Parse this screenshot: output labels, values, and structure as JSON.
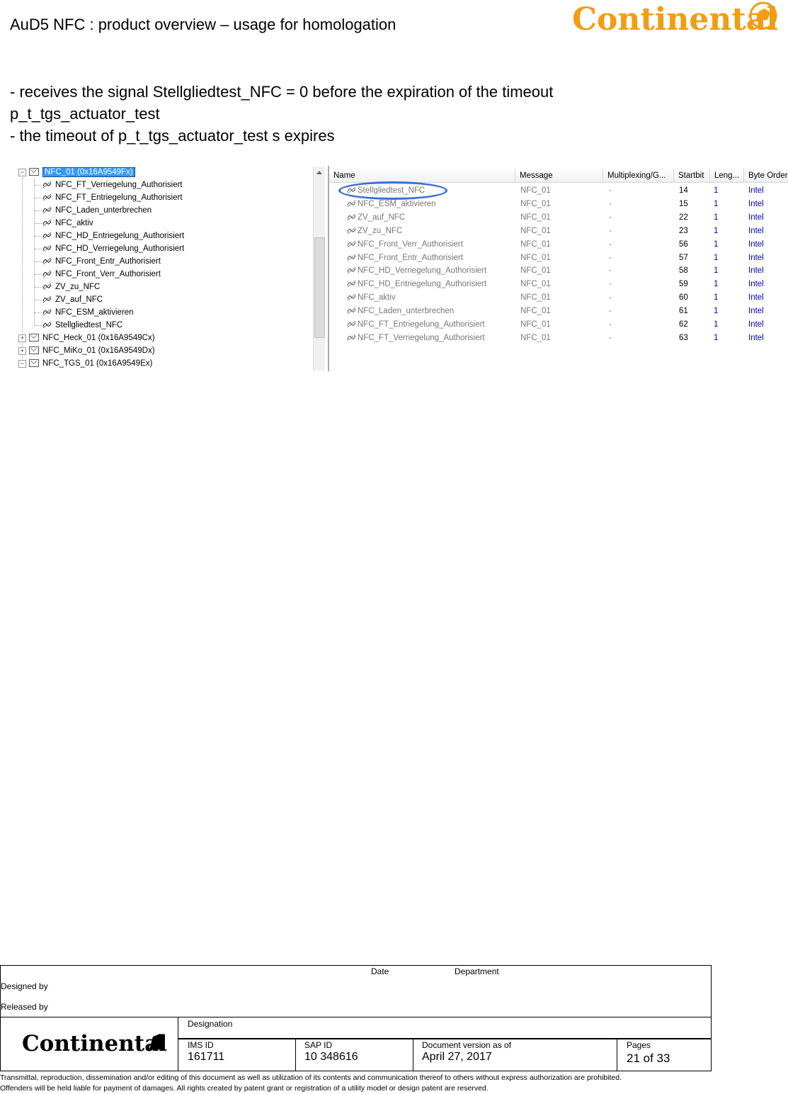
{
  "header": {
    "title": "AuD5 NFC : product overview – usage for homologation",
    "logo_text": "Continental"
  },
  "body": {
    "lines": [
      "- receives the signal Stellgliedtest_NFC = 0 before the expiration of the timeout",
      "p_t_tgs_actuator_test",
      "- the timeout of p_t_tgs_actuator_test s expires"
    ]
  },
  "tree": {
    "root": "NFC_01 (0x16A9549Fx)",
    "children": [
      "NFC_FT_Verriegelung_Authorisiert",
      "NFC_FT_Entriegelung_Authorisiert",
      "NFC_Laden_unterbrechen",
      "NFC_aktiv",
      "NFC_HD_Entriegelung_Authorisiert",
      "NFC_HD_Verriegelung_Authorisiert",
      "NFC_Front_Entr_Authorisiert",
      "NFC_Front_Verr_Authorisiert",
      "ZV_zu_NFC",
      "ZV_auf_NFC",
      "NFC_ESM_aktivieren",
      "Stellgliedtest_NFC"
    ],
    "siblings": [
      "NFC_Heck_01 (0x16A9549Cx)",
      "NFC_MiKo_01 (0x16A9549Dx)",
      "NFC_TGS_01 (0x16A9549Ex)"
    ]
  },
  "grid": {
    "columns": [
      "Name",
      "Message",
      "Multiplexing/G...",
      "Startbit",
      "Leng...",
      "Byte Order"
    ],
    "rows": [
      {
        "name": "Stellgliedtest_NFC",
        "message": "NFC_01",
        "mux": "-",
        "startbit": "14",
        "length": "1",
        "order": "Intel"
      },
      {
        "name": "NFC_ESM_aktivieren",
        "message": "NFC_01",
        "mux": "-",
        "startbit": "15",
        "length": "1",
        "order": "Intel"
      },
      {
        "name": "ZV_auf_NFC",
        "message": "NFC_01",
        "mux": "-",
        "startbit": "22",
        "length": "1",
        "order": "Intel"
      },
      {
        "name": "ZV_zu_NFC",
        "message": "NFC_01",
        "mux": "-",
        "startbit": "23",
        "length": "1",
        "order": "Intel"
      },
      {
        "name": "NFC_Front_Verr_Authorisiert",
        "message": "NFC_01",
        "mux": "-",
        "startbit": "56",
        "length": "1",
        "order": "Intel"
      },
      {
        "name": "NFC_Front_Entr_Authorisiert",
        "message": "NFC_01",
        "mux": "-",
        "startbit": "57",
        "length": "1",
        "order": "Intel"
      },
      {
        "name": "NFC_HD_Verriegelung_Authorisiert",
        "message": "NFC_01",
        "mux": "-",
        "startbit": "58",
        "length": "1",
        "order": "Intel"
      },
      {
        "name": "NFC_HD_Entriegelung_Authorisiert",
        "message": "NFC_01",
        "mux": "-",
        "startbit": "59",
        "length": "1",
        "order": "Intel"
      },
      {
        "name": "NFC_aktiv",
        "message": "NFC_01",
        "mux": "-",
        "startbit": "60",
        "length": "1",
        "order": "Intel"
      },
      {
        "name": "NFC_Laden_unterbrechen",
        "message": "NFC_01",
        "mux": "-",
        "startbit": "61",
        "length": "1",
        "order": "Intel"
      },
      {
        "name": "NFC_FT_Entriegelung_Authorisiert",
        "message": "NFC_01",
        "mux": "-",
        "startbit": "62",
        "length": "1",
        "order": "Intel"
      },
      {
        "name": "NFC_FT_Verriegelung_Authorisiert",
        "message": "NFC_01",
        "mux": "-",
        "startbit": "63",
        "length": "1",
        "order": "Intel"
      }
    ]
  },
  "footer": {
    "date_label": "Date",
    "department_label": "Department",
    "designed_by": "Designed by",
    "released_by": "Released by",
    "designation_label": "Designation",
    "logo_text": "Continental",
    "ims_label": "IMS  ID",
    "ims_value": "161711",
    "sap_label": "SAP  ID",
    "sap_value": "10 348616",
    "docver_label": "Document version as of",
    "docver_value": "April 27, 2017",
    "pages_label": "Pages",
    "pages_value": "21 of 33",
    "disclaimer_1": "Transmittal, reproduction, dissemination and/or editing of this document as well as utilization of its contents and communication thereof to others without express authorization are prohibited.",
    "disclaimer_2": "Offenders will be held liable for payment of damages. All rights created by patent grant or registration of a utility model or design patent are reserved."
  },
  "colors": {
    "logo_orange": "#f39c12",
    "selection": "#3399ff",
    "highlight_ellipse": "#3a6fd8",
    "grid_blue": "#0000cc"
  }
}
